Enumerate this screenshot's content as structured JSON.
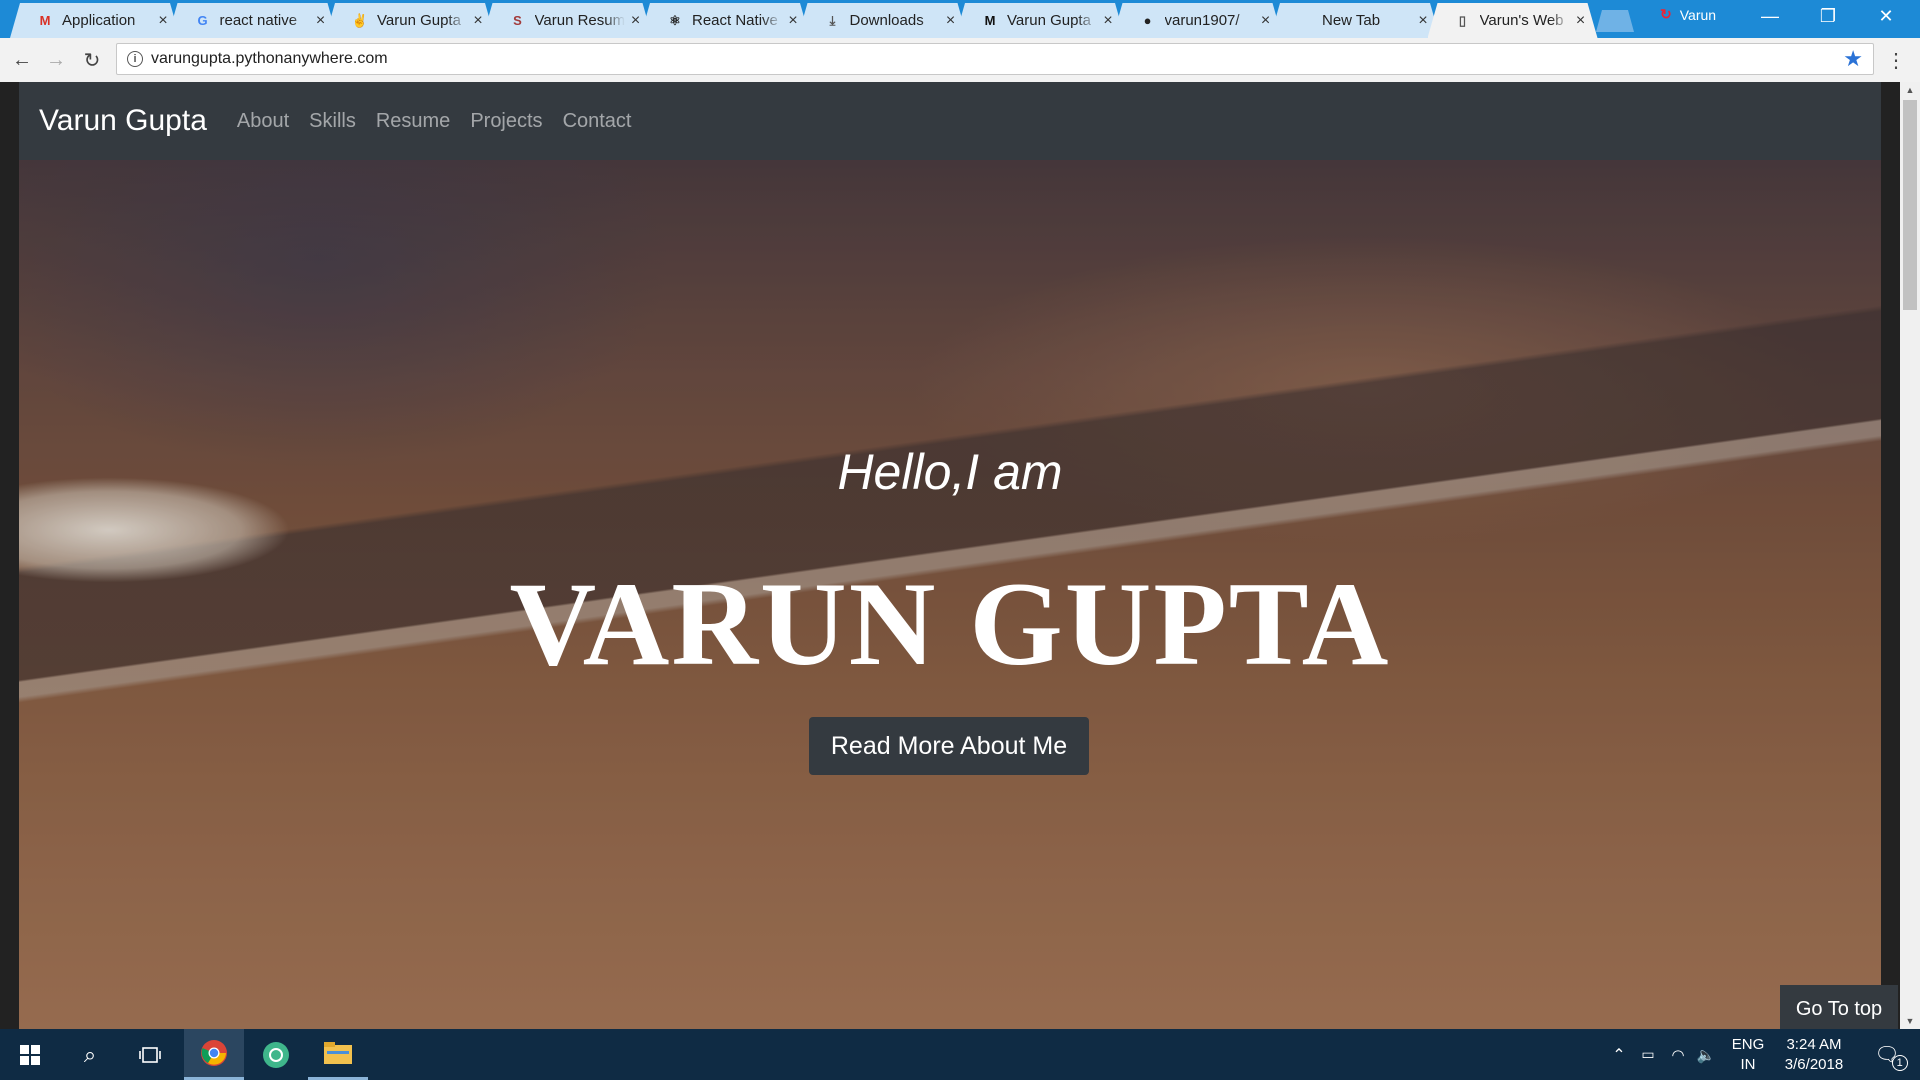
{
  "browser": {
    "tabs": [
      {
        "label": "Application",
        "icon": "gmail-icon",
        "glyph": "M",
        "color": "#d93025"
      },
      {
        "label": "react native",
        "icon": "google-icon",
        "glyph": "G",
        "color": "#4285f4"
      },
      {
        "label": "Varun Gupta",
        "icon": "peace-hand-icon",
        "glyph": "✌",
        "color": "#555555"
      },
      {
        "label": "Varun Resume",
        "icon": "s-logo-icon",
        "glyph": "S",
        "color": "#a23b3b"
      },
      {
        "label": "React Native",
        "icon": "react-logo-icon",
        "glyph": "⚛",
        "color": "#222222"
      },
      {
        "label": "Downloads",
        "icon": "download-icon",
        "glyph": "⤓",
        "color": "#555555"
      },
      {
        "label": "Varun Gupta",
        "icon": "medium-logo-icon",
        "glyph": "M",
        "color": "#111111"
      },
      {
        "label": "varun1907/",
        "icon": "github-icon",
        "glyph": "●",
        "color": "#222222"
      },
      {
        "label": "New Tab",
        "icon": "",
        "glyph": "",
        "color": "#555555"
      },
      {
        "label": "Varun's Web",
        "icon": "page-icon",
        "glyph": "▯",
        "color": "#555555"
      }
    ],
    "close_glyph": "×",
    "profile_name": "Varun",
    "address": "varungupta.pythonanywhere.com"
  },
  "site": {
    "brand": "Varun Gupta",
    "nav": [
      "About",
      "Skills",
      "Resume",
      "Projects",
      "Contact"
    ],
    "greeting": "Hello,I am",
    "name": "VARUN GUPTA",
    "cta": "Read More About Me",
    "go_top": "Go To top"
  },
  "taskbar": {
    "language": "ENG",
    "region": "IN",
    "time": "3:24 AM",
    "date": "3/6/2018",
    "notification_count": "1"
  },
  "colors": {
    "tabstrip": "#1d8ad6",
    "site_nav": "#343a40",
    "taskbar": "#0f2b44"
  }
}
